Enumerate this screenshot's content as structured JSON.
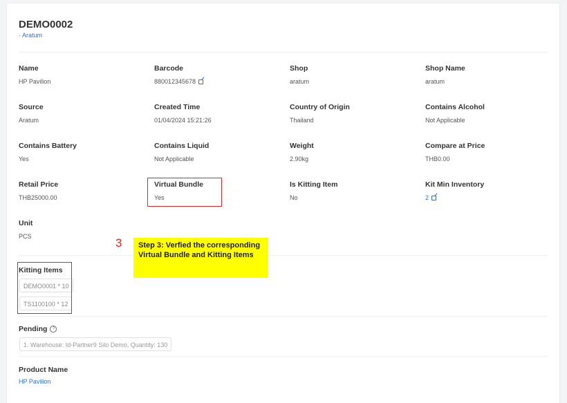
{
  "header": {
    "title": "DEMO0002",
    "subtitle": "· Aratum"
  },
  "fields": {
    "name": {
      "label": "Name",
      "value": "HP Pavilion"
    },
    "barcode": {
      "label": "Barcode",
      "value": "880012345678"
    },
    "shop": {
      "label": "Shop",
      "value": "aratum"
    },
    "shop_name": {
      "label": "Shop Name",
      "value": "aratum"
    },
    "source": {
      "label": "Source",
      "value": "Aratum"
    },
    "created_time": {
      "label": "Created Time",
      "value": "01/04/2024 15:21:26"
    },
    "country_of_origin": {
      "label": "Country of Origin",
      "value": "Thailand"
    },
    "contains_alcohol": {
      "label": "Contains Alcohol",
      "value": "Not Applicable"
    },
    "contains_battery": {
      "label": "Contains Battery",
      "value": "Yes"
    },
    "contains_liquid": {
      "label": "Contains Liquid",
      "value": "Not Applicable"
    },
    "weight": {
      "label": "Weight",
      "value": "2.90kg"
    },
    "compare_at_price": {
      "label": "Compare at Price",
      "value": "THB0.00"
    },
    "retail_price": {
      "label": "Retail Price",
      "value": "THB25000.00"
    },
    "virtual_bundle": {
      "label": "Virtual Bundle",
      "value": "Yes"
    },
    "is_kitting_item": {
      "label": "Is Kitting Item",
      "value": "No"
    },
    "kit_min_inventory": {
      "label": "Kit Min Inventory",
      "value": "2"
    },
    "unit": {
      "label": "Unit",
      "value": "PCS"
    }
  },
  "annotation": {
    "step_number": "3",
    "text": "Step 3: Verfied the corresponding Virtual Bundle and Kitting Items",
    "highlight_color": "#ffff00",
    "box_color": "#d9262a"
  },
  "kitting": {
    "label": "Kitting Items",
    "items": [
      "DEMO0001 * 10",
      "TS1100100 * 12"
    ]
  },
  "pending": {
    "label": "Pending",
    "items": [
      "1. Warehouse: Id-Partner9 Silo Demo, Quantity: 130"
    ]
  },
  "product_name": {
    "label": "Product Name",
    "value": "HP Pavilion"
  },
  "colors": {
    "link": "#2f6fe0",
    "accent_red": "#d9262a"
  },
  "icons": {
    "edit": "edit-icon",
    "help": "help-circle-icon"
  }
}
